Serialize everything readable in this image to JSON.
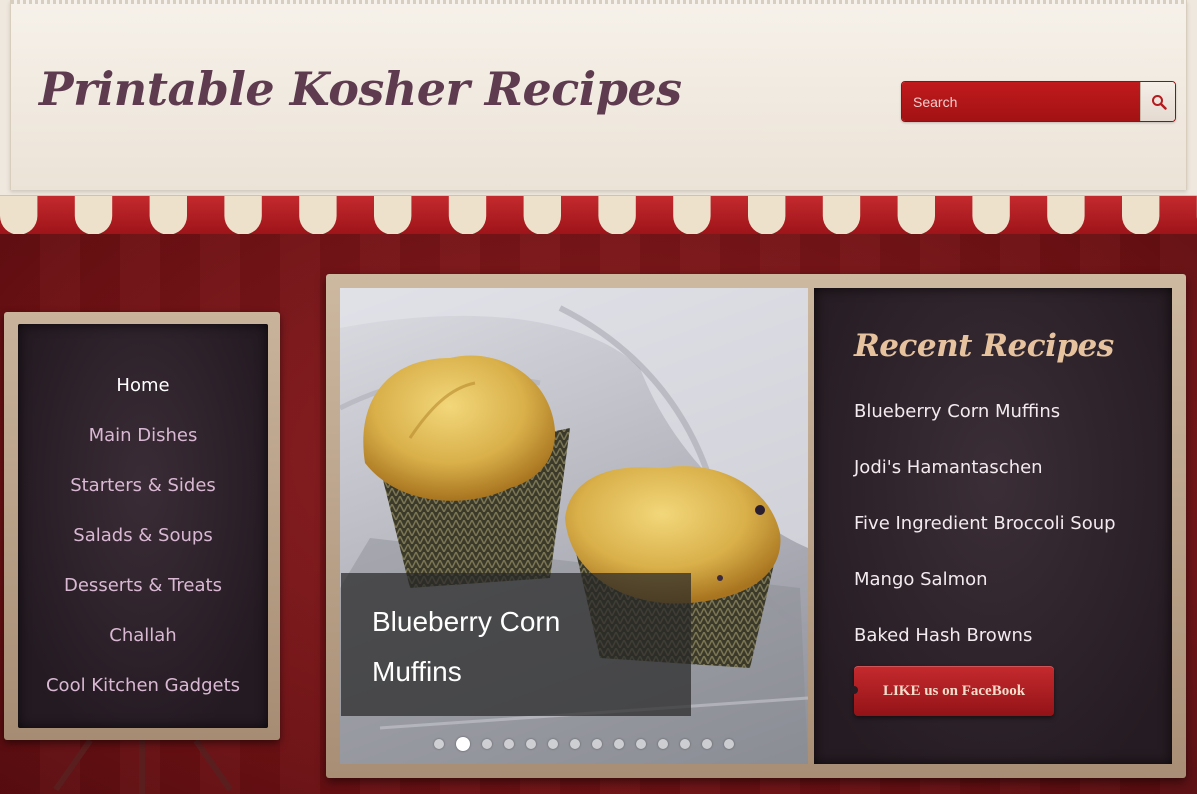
{
  "header": {
    "site_title": "Printable Kosher Recipes",
    "search": {
      "placeholder": "Search",
      "value": ""
    }
  },
  "nav": {
    "items": [
      {
        "label": "Home",
        "active": true
      },
      {
        "label": "Main Dishes"
      },
      {
        "label": "Starters & Sides"
      },
      {
        "label": "Salads & Soups"
      },
      {
        "label": "Desserts & Treats"
      },
      {
        "label": "Challah"
      },
      {
        "label": "Cool Kitchen Gadgets"
      }
    ]
  },
  "slider": {
    "caption_line1": "Blueberry Corn",
    "caption_line2": "Muffins",
    "dot_count": 14,
    "active_dot": 2
  },
  "recent": {
    "title": "Recent Recipes",
    "items": [
      "Blueberry Corn Muffins",
      "Jodi's Hamantaschen",
      "Five Ingredient Broccoli Soup",
      "Mango Salmon",
      "Baked Hash Browns"
    ],
    "facebook_label": "LIKE us on FaceBook"
  },
  "colors": {
    "title_purple": "#5e3b4f",
    "awning_red": "#b01a22",
    "awning_cream": "#eee1cc",
    "chalk_text": "#d9b8d3",
    "recent_title": "#e6c39e"
  },
  "icons": [
    "search-icon"
  ]
}
